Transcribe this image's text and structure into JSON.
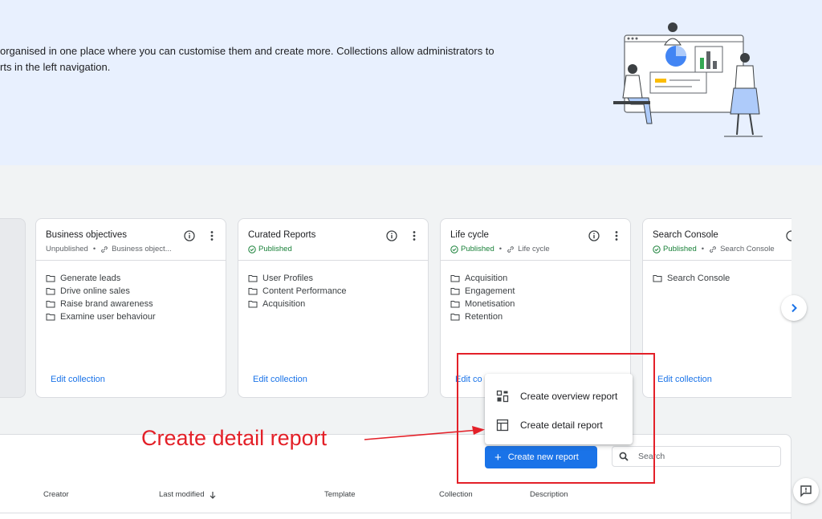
{
  "hero": {
    "line1": "organised in one place where you can customise them and create more. Collections allow administrators to",
    "line2": "rts in the left navigation."
  },
  "cards": [
    {
      "title": "Business objectives",
      "status": "Unpublished",
      "link": "Business object...",
      "items": [
        "Generate leads",
        "Drive online sales",
        "Raise brand awareness",
        "Examine user behaviour"
      ],
      "edit": "Edit collection"
    },
    {
      "title": "Curated Reports",
      "status": "Published",
      "link": "",
      "items": [
        "User Profiles",
        "Content Performance",
        "Acquisition"
      ],
      "edit": "Edit collection"
    },
    {
      "title": "Life cycle",
      "status": "Published",
      "link": "Life cycle",
      "items": [
        "Acquisition",
        "Engagement",
        "Monetisation",
        "Retention"
      ],
      "edit": "Edit co"
    },
    {
      "title": "Search Console",
      "status": "Published",
      "link": "Search Console",
      "items": [
        "Search Console"
      ],
      "edit": "Edit collection"
    }
  ],
  "menu": {
    "items": [
      "Create overview report",
      "Create detail report"
    ],
    "icons": [
      "overview-report-icon",
      "detail-report-icon"
    ]
  },
  "toolbar": {
    "create_label": "Create new report",
    "search_placeholder": "Search"
  },
  "table": {
    "columns": [
      "Creator",
      "Last modified",
      "Template",
      "Collection",
      "Description"
    ],
    "sorted_column": "Last modified"
  },
  "annotation": {
    "text": "Create detail report",
    "color": "#e32028"
  },
  "colors": {
    "accent": "#1a73e8",
    "published": "#188038",
    "hero_bg": "#e8f0fe"
  }
}
